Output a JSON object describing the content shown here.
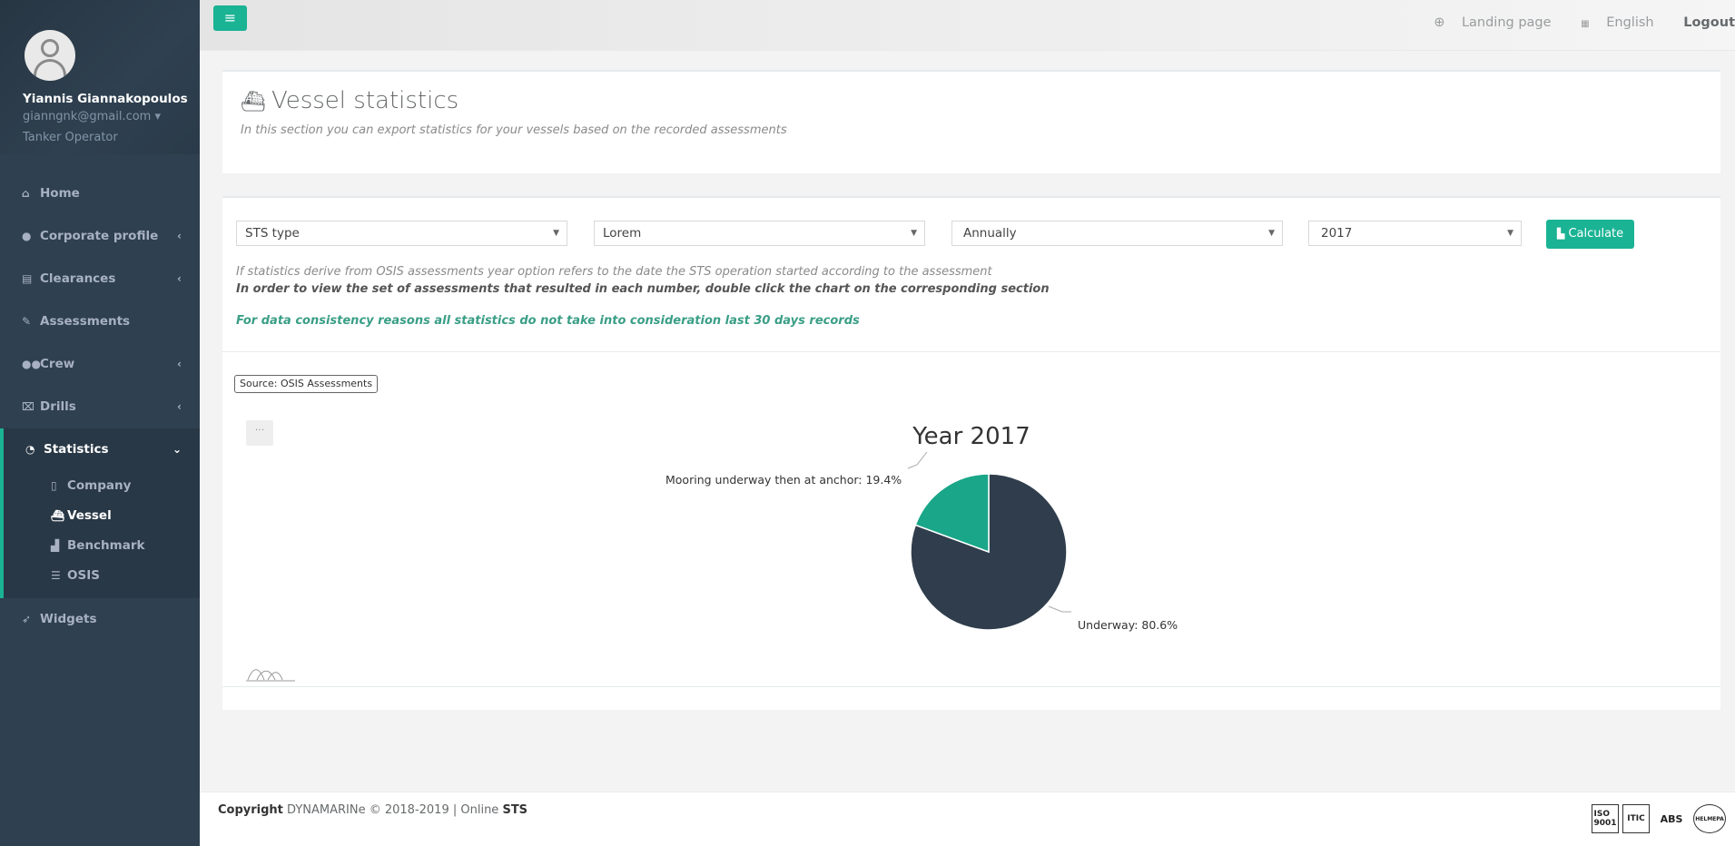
{
  "user": {
    "name": "Yiannis Giannakopoulos",
    "email": "gianngnk@gmail.com",
    "role": "Tanker Operator"
  },
  "sidebar": {
    "items": [
      {
        "label": "Home",
        "icon": "home-icon"
      },
      {
        "label": "Corporate profile",
        "icon": "user-icon"
      },
      {
        "label": "Clearances",
        "icon": "archive-icon"
      },
      {
        "label": "Assessments",
        "icon": "edit-icon"
      },
      {
        "label": "Crew",
        "icon": "users-icon"
      },
      {
        "label": "Drills",
        "icon": "drill-icon"
      },
      {
        "label": "Statistics",
        "icon": "pie-chart-icon"
      },
      {
        "label": "Widgets",
        "icon": "rocket-icon"
      }
    ],
    "statistics_sub": [
      {
        "label": "Company",
        "icon": "building-icon"
      },
      {
        "label": "Vessel",
        "icon": "ship-icon"
      },
      {
        "label": "Benchmark",
        "icon": "chart-icon"
      },
      {
        "label": "OSIS",
        "icon": "database-icon"
      }
    ]
  },
  "topbar": {
    "landing": "Landing page",
    "language": "English",
    "logout": "Logout"
  },
  "page": {
    "title": "Vessel statistics",
    "description": "In this section you can export statistics for your vessels based on the recorded assessments"
  },
  "filters": {
    "sts_type": "STS type",
    "vessel": "Lorem",
    "period": "Annually",
    "year": "2017",
    "calculate": "Calculate"
  },
  "notes": {
    "note1": "If statistics derive from OSIS assessments year option refers to the date the STS operation started according to the assessment",
    "note2": "In order to view the set of assessments that resulted in each number, double click the chart on the corresponding section",
    "note3": "For data consistency reasons all statistics do not take into consideration last 30 days records"
  },
  "source_label": "Source: OSIS Assessments",
  "chart_menu": "···",
  "chart_data": {
    "type": "pie",
    "title": "Year 2017",
    "slices": [
      {
        "label": "Underway",
        "value": 80.6,
        "color": "#2f3d4c"
      },
      {
        "label": "Mooring underway then at anchor",
        "value": 19.4,
        "color": "#1aa688"
      }
    ],
    "labels": [
      "Underway: 80.6%",
      "Mooring underway then at anchor: 19.4%"
    ]
  },
  "footer": {
    "copyright_label": "Copyright",
    "copyright_text": "DYNAMARINe © 2018-2019 | Online",
    "brand": "STS",
    "logos": [
      "ISO 9001",
      "ITIC",
      "ABS",
      "HELMEPA"
    ]
  }
}
